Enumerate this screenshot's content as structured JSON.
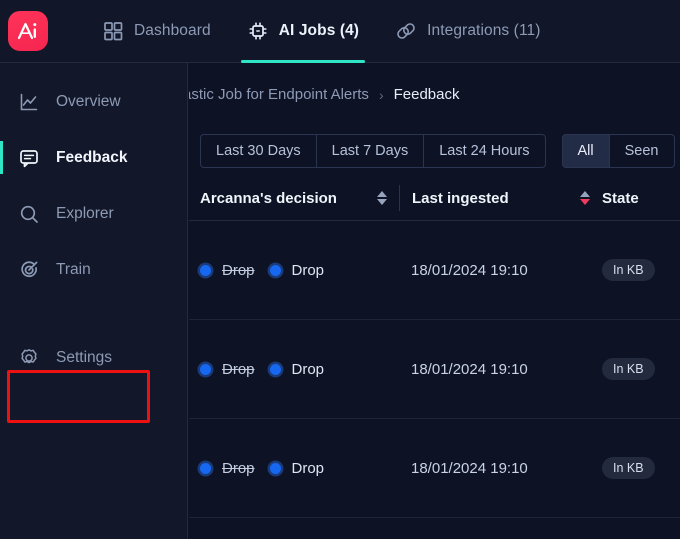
{
  "app": {
    "logo_name": "arcanna-logo",
    "accent_teal": "#2ee6c5",
    "accent_pink": "#f5254f",
    "annotation_color": "#ee1111"
  },
  "topnav": {
    "tabs": [
      {
        "label": "Dashboard",
        "icon": "grid-icon",
        "active": false
      },
      {
        "label": "AI Jobs (4)",
        "icon": "chip-icon",
        "active": true
      },
      {
        "label": "Integrations (11)",
        "icon": "plug-icon",
        "active": false
      }
    ]
  },
  "sidebar": {
    "items": [
      {
        "label": "Overview",
        "icon": "chart-line-icon",
        "active": false
      },
      {
        "label": "Feedback",
        "icon": "message-icon",
        "active": true
      },
      {
        "label": "Explorer",
        "icon": "search-icon",
        "active": false
      },
      {
        "label": "Train",
        "icon": "target-icon",
        "active": false
      },
      {
        "label": "Settings",
        "icon": "gear-icon",
        "active": false,
        "highlighted": true
      }
    ]
  },
  "breadcrumb": {
    "parent": "astic Job for Endpoint Alerts",
    "separator": "›",
    "current": "Feedback"
  },
  "filters": {
    "range_buttons": [
      {
        "label": "Last 30 Days",
        "selected": false
      },
      {
        "label": "Last 7 Days",
        "selected": false
      },
      {
        "label": "Last 24 Hours",
        "selected": false
      }
    ],
    "status_buttons": [
      {
        "label": "All",
        "selected": true
      },
      {
        "label": "Seen",
        "selected": false
      }
    ]
  },
  "table": {
    "columns": [
      {
        "label": "Arcanna's decision",
        "sortable": true,
        "sort": "none"
      },
      {
        "label": "Last ingested",
        "sortable": true,
        "sort": "desc"
      },
      {
        "label": "State",
        "sortable": false,
        "sort": "none"
      }
    ],
    "rows": [
      {
        "decision_previous": "Drop",
        "decision_current": "Drop",
        "last_ingested": "18/01/2024 19:10",
        "state": "In KB"
      },
      {
        "decision_previous": "Drop",
        "decision_current": "Drop",
        "last_ingested": "18/01/2024 19:10",
        "state": "In KB"
      },
      {
        "decision_previous": "Drop",
        "decision_current": "Drop",
        "last_ingested": "18/01/2024 19:10",
        "state": "In KB"
      }
    ]
  }
}
